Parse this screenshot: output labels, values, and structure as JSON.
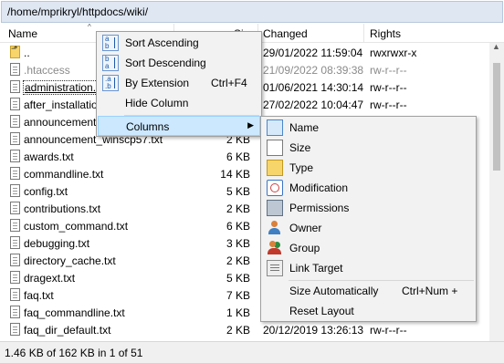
{
  "path": "/home/mprikryl/httpdocs/wiki/",
  "columns": {
    "name": "Name",
    "size": "Si",
    "changed": "Changed",
    "rights": "Rights"
  },
  "files": [
    {
      "name": "..",
      "size": "",
      "changed": "29/01/2022 11:59:04",
      "rights": "rwxrwxr-x",
      "type": "parent"
    },
    {
      "name": ".htaccess",
      "size": "",
      "changed": "21/09/2022 08:39:38",
      "rights": "rw-r--r--",
      "type": "file"
    },
    {
      "name": "administration.",
      "size": "",
      "changed": "01/06/2021 14:30:14",
      "rights": "rw-r--r--",
      "type": "file"
    },
    {
      "name": "after_installatio",
      "size": "",
      "changed": "27/02/2022 10:04:47",
      "rights": "rw-r--r--",
      "type": "file"
    },
    {
      "name": "announcement",
      "size": "",
      "changed": "",
      "rights": "",
      "type": "file"
    },
    {
      "name": "announcement_winscp57.txt",
      "size": "2 KB",
      "changed": "",
      "rights": "",
      "type": "file"
    },
    {
      "name": "awards.txt",
      "size": "6 KB",
      "changed": "",
      "rights": "",
      "type": "file"
    },
    {
      "name": "commandline.txt",
      "size": "14 KB",
      "changed": "",
      "rights": "",
      "type": "file"
    },
    {
      "name": "config.txt",
      "size": "5 KB",
      "changed": "",
      "rights": "",
      "type": "file"
    },
    {
      "name": "contributions.txt",
      "size": "2 KB",
      "changed": "",
      "rights": "",
      "type": "file"
    },
    {
      "name": "custom_command.txt",
      "size": "6 KB",
      "changed": "",
      "rights": "",
      "type": "file"
    },
    {
      "name": "debugging.txt",
      "size": "3 KB",
      "changed": "",
      "rights": "",
      "type": "file"
    },
    {
      "name": "directory_cache.txt",
      "size": "2 KB",
      "changed": "",
      "rights": "",
      "type": "file"
    },
    {
      "name": "dragext.txt",
      "size": "5 KB",
      "changed": "",
      "rights": "",
      "type": "file"
    },
    {
      "name": "faq.txt",
      "size": "7 KB",
      "changed": "",
      "rights": "",
      "type": "file"
    },
    {
      "name": "faq_commandline.txt",
      "size": "1 KB",
      "changed": "",
      "rights": "",
      "type": "file"
    },
    {
      "name": "faq_dir_default.txt",
      "size": "2 KB",
      "changed": "20/12/2019 13:26:13",
      "rights": "rw-r--r--",
      "type": "file"
    }
  ],
  "status": "1.46 KB of 162 KB in 1 of 51",
  "context_menu": {
    "sort_ascending": "Sort Ascending",
    "sort_descending": "Sort Descending",
    "by_extension": "By Extension",
    "by_extension_shortcut": "Ctrl+F4",
    "hide_column": "Hide Column",
    "columns": "Columns"
  },
  "columns_submenu": {
    "name": "Name",
    "size": "Size",
    "type": "Type",
    "modification": "Modification",
    "permissions": "Permissions",
    "owner": "Owner",
    "group": "Group",
    "link_target": "Link Target",
    "size_automatically": "Size Automatically",
    "size_automatically_shortcut": "Ctrl+Num +",
    "reset_layout": "Reset Layout"
  }
}
